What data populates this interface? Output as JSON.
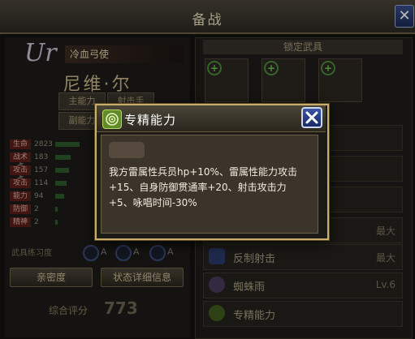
{
  "window": {
    "title": "备战"
  },
  "hero": {
    "class_mark": "Ur",
    "subtitle": "冷血弓使",
    "name": "尼维·尔",
    "tags": [
      "主能力",
      "射击手",
      "副能力"
    ],
    "stats": [
      {
        "label": "生命",
        "value": "2823",
        "fill": 0.55
      },
      {
        "label": "战术点",
        "value": "183",
        "fill": 0.35
      },
      {
        "label": "攻击点",
        "value": "157",
        "fill": 0.3
      },
      {
        "label": "攻击",
        "value": "114",
        "fill": 0.25
      },
      {
        "label": "能力",
        "value": "94",
        "fill": 0.2
      },
      {
        "label": "防御",
        "value": "2",
        "fill": 0.05
      },
      {
        "label": "精神",
        "value": "2",
        "fill": 0.05
      }
    ],
    "skill_rank_label": "武具练习度",
    "skill_grades": [
      "A",
      "A",
      "A"
    ],
    "buttons": {
      "intimacy": "亲密度",
      "status_detail": "状态详细信息"
    },
    "power_label": "综合评分",
    "power_value": "773"
  },
  "right": {
    "lock_title": "锁定武具",
    "rows": [
      {
        "label": "",
        "value": ""
      },
      {
        "label": "",
        "value": ""
      },
      {
        "label": "",
        "value": ""
      },
      {
        "label": "",
        "value": "最大"
      },
      {
        "label": "反制射击",
        "value": "最大"
      },
      {
        "label": "蜘蛛雨",
        "value": "Lv.6"
      },
      {
        "label": "专精能力",
        "value": ""
      }
    ]
  },
  "dialog": {
    "title": "专精能力",
    "description": "我方雷属性兵员hp+10%、雷属性能力攻击+15、自身防御贯通率+20、射击攻击力+5、咏唱时间-30%"
  },
  "colors": {
    "dialog_border": "#c8ad6b",
    "dialog_body": "#3a342b",
    "close_blue": "#2a4594",
    "skill_icon_green": "#5f8c24"
  }
}
